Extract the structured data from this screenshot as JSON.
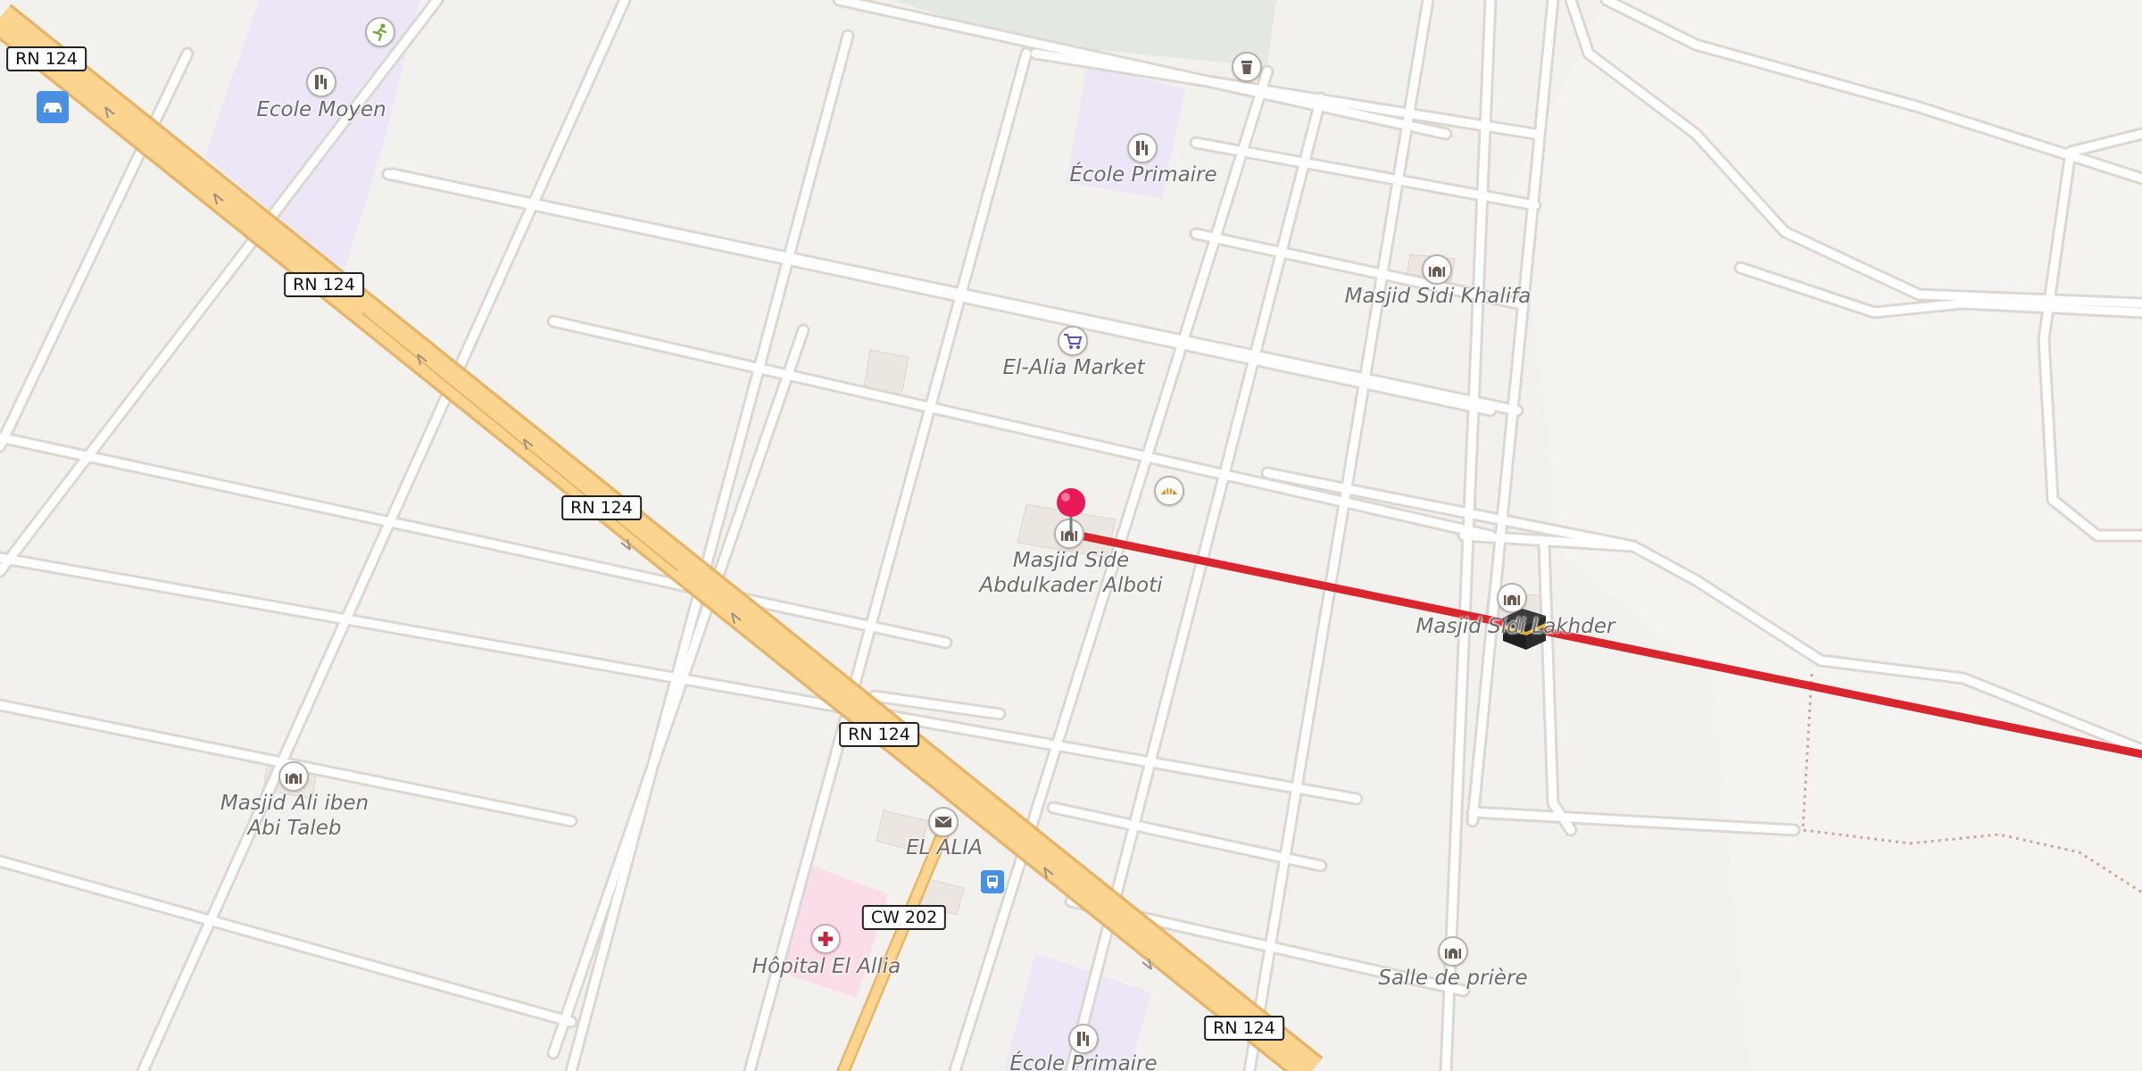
{
  "map": {
    "road_shields": [
      "RN 124",
      "RN 124",
      "RN 124",
      "RN 124",
      "RN 124",
      "CW 202"
    ],
    "places": {
      "ecole_moyen": "Ecole Moyen",
      "ecole_primaire_north": "École Primaire",
      "masjid_sidi_khalifa": "Masjid Sidi Khalifa",
      "el_alia_market": "El-Alia Market",
      "masjid_side_line1": "Masjid Side",
      "masjid_side_line2": "Abdulkader Alboti",
      "masjid_lakhder": "Masjid Sidi Lakhder",
      "masjid_ali_line1": "Masjid Ali iben",
      "masjid_ali_line2": "Abi Taleb",
      "el_alia": "EL ALIA",
      "hopital": "Hôpital El Allia",
      "salle_de_priere": "Salle de prière",
      "ecole_primaire_south": "École Primaire"
    },
    "icons": {
      "school": "school-icon",
      "mosque": "mosque-icon",
      "market": "shopping-cart-icon",
      "bakery": "bakery-icon",
      "post": "post-office-icon",
      "hospital": "hospital-icon",
      "bus": "bus-stop-icon",
      "car": "car-parking-icon",
      "sport": "sport-icon",
      "waste": "waste-basket-icon",
      "pin": "location-pin-icon",
      "kaaba": "kaaba-icon"
    },
    "colors": {
      "background": "#f3f1ee",
      "street": "#ffffff",
      "street_casing": "#dedad5",
      "trunk_road": "#fbd58f",
      "trunk_casing": "#e5b66c",
      "qibla_line": "#d8262f",
      "school_area": "#ece6f7",
      "hospital_area": "#fbdde9",
      "pin": "#e8195a"
    }
  }
}
